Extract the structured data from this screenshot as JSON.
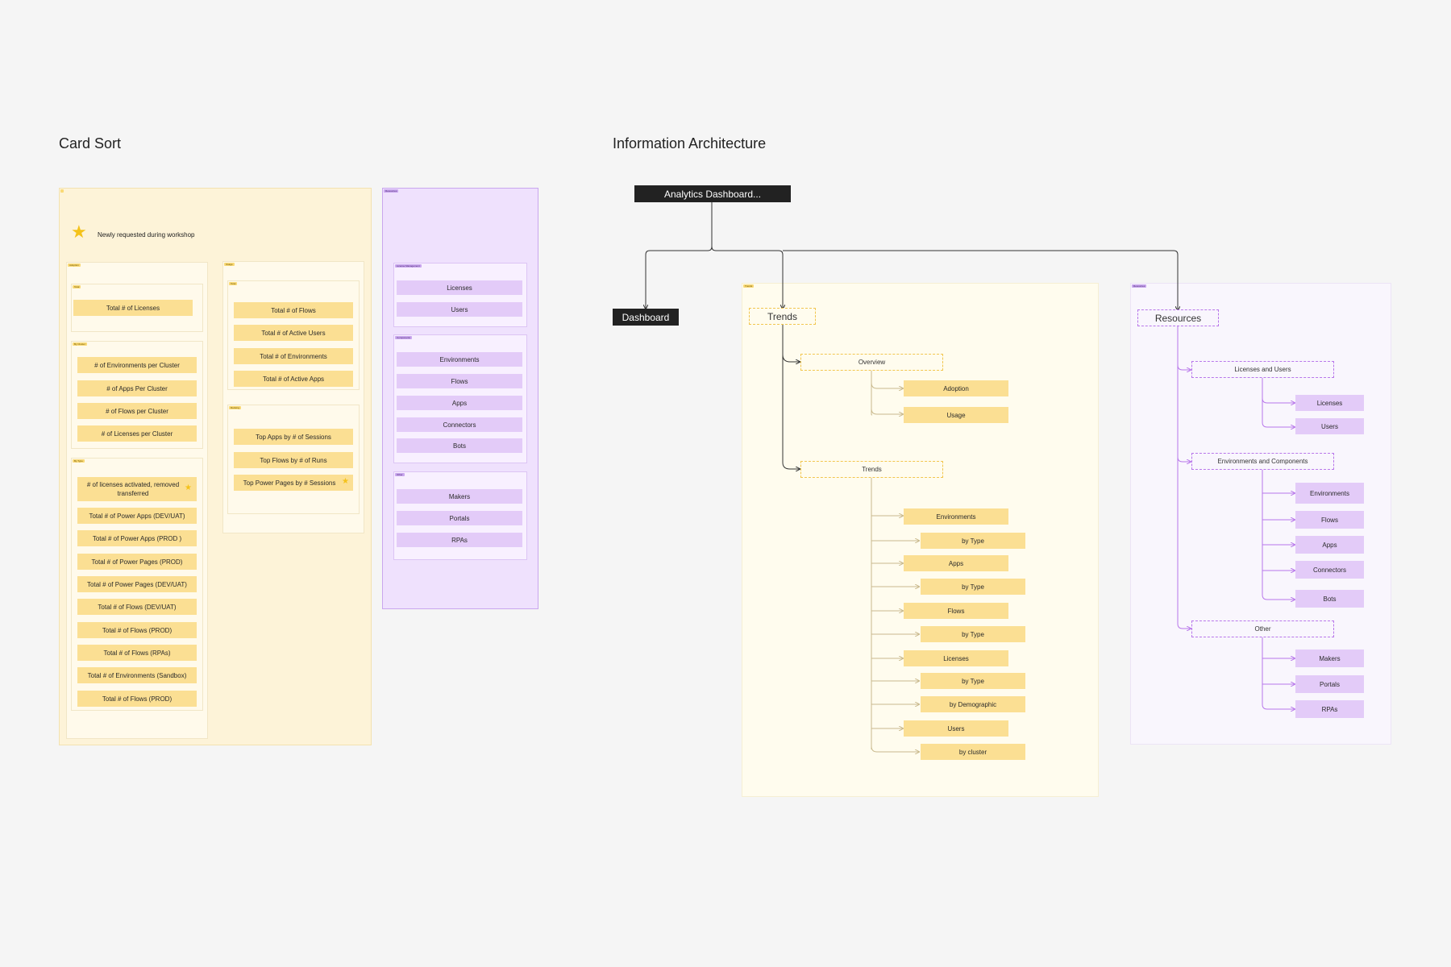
{
  "card_sort": {
    "title": "Card Sort",
    "legend": "Newly requested during workshop",
    "adoption": {
      "tag": "Adoption",
      "total": {
        "tag": "Total",
        "cards": [
          "Total # of Licenses"
        ]
      },
      "by_cluster": {
        "tag": "By Cluster",
        "cards": [
          "# of Environments per Cluster",
          "# of Apps Per Cluster",
          "# of Flows per Cluster",
          "# of Licenses per Cluster"
        ]
      },
      "by_type": {
        "tag": "By Type",
        "cards": [
          "# of licenses activated, removed transferred",
          "Total  # of Power Apps (DEV/UAT)",
          "Total  # of Power Apps (PROD )",
          "Total  # of Power Pages (PROD)",
          "Total  # of Power Pages (DEV/UAT)",
          "Total  # of Flows (DEV/UAT)",
          "Total  # of Flows (PROD)",
          "Total  # of Flows (RPAs)",
          "Total  # of Environments (Sandbox)",
          "Total  # of Flows (PROD)"
        ]
      }
    },
    "usage": {
      "tag": "Usage",
      "total": {
        "tag": "Total",
        "cards": [
          "Total # of Flows",
          "Total # of Active Users",
          "Total # of Environments",
          "Total  # of Active Apps"
        ]
      },
      "ranking": {
        "tag": "Ranking",
        "cards": [
          "Top Apps by # of Sessions",
          "Top Flows by # of Runs",
          "Top Power Pages by # Sessions"
        ]
      }
    },
    "resources": {
      "tag": "Resources",
      "license": {
        "tag": "License Management",
        "cards": [
          "Licenses",
          "Users"
        ]
      },
      "components": {
        "tag": "Components",
        "cards": [
          "Environments",
          "Flows",
          "Apps",
          "Connectors",
          "Bots"
        ]
      },
      "other": {
        "tag": "Other",
        "cards": [
          "Makers",
          "Portals",
          "RPAs"
        ]
      }
    }
  },
  "ia": {
    "title": "Information Architecture",
    "root": "Analytics Dashboard...",
    "dashboard": "Dashboard",
    "trends_tag": "Trends",
    "trends": "Trends",
    "overview": "Overview",
    "adoption": "Adoption",
    "usage": "Usage",
    "trends_sub": "Trends",
    "trend_items": [
      "Environments",
      "by Type",
      "Apps",
      "by Type",
      "Flows",
      "by Type",
      "Licenses",
      "by Type",
      "by Demographic",
      "Users",
      "by cluster"
    ],
    "resources_tag": "Resources",
    "resources": "Resources",
    "lic_users": "Licenses and Users",
    "lic_items": [
      "Licenses",
      "Users"
    ],
    "env_comp": "Environments and Components",
    "env_items": [
      "Environments",
      "Flows",
      "Apps",
      "Connectors",
      "Bots"
    ],
    "other": "Other",
    "other_items": [
      "Makers",
      "Portals",
      "RPAs"
    ]
  },
  "colors": {
    "yellow_card": "#fbdf93",
    "purple_card": "#e3cbf8",
    "purple_line": "#b877ea",
    "dark": "#222222"
  }
}
